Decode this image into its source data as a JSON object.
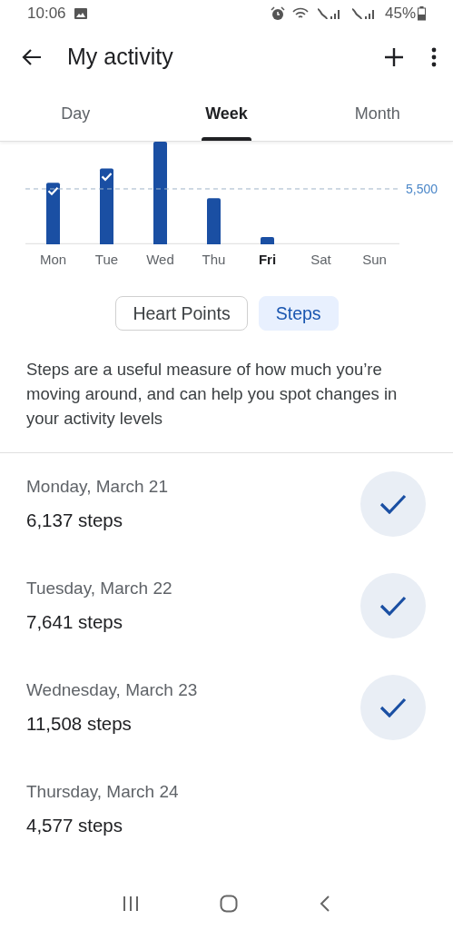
{
  "status_bar": {
    "time": "10:06",
    "battery": "45%"
  },
  "header": {
    "title": "My activity"
  },
  "tabs": [
    {
      "label": "Day",
      "selected": false
    },
    {
      "label": "Week",
      "selected": true
    },
    {
      "label": "Month",
      "selected": false
    }
  ],
  "chart": {
    "goal_label": "5,500",
    "days": [
      {
        "label": "Mon",
        "selected": false,
        "goal_met": true
      },
      {
        "label": "Tue",
        "selected": false,
        "goal_met": true
      },
      {
        "label": "Wed",
        "selected": false,
        "goal_met": false
      },
      {
        "label": "Thu",
        "selected": false,
        "goal_met": false
      },
      {
        "label": "Fri",
        "selected": true,
        "goal_met": false
      },
      {
        "label": "Sat",
        "selected": false,
        "goal_met": false
      },
      {
        "label": "Sun",
        "selected": false,
        "goal_met": false
      }
    ]
  },
  "metric_toggle": [
    {
      "label": "Heart Points",
      "selected": false
    },
    {
      "label": "Steps",
      "selected": true
    }
  ],
  "description": "Steps are a useful measure of how much you’re moving around, and can help you spot changes in your activity levels",
  "days": [
    {
      "date": "Monday, March 21",
      "steps": "6,137 steps",
      "goal_met": true
    },
    {
      "date": "Tuesday, March 22",
      "steps": "7,641 steps",
      "goal_met": true
    },
    {
      "date": "Wednesday, March 23",
      "steps": "11,508 steps",
      "goal_met": true
    },
    {
      "date": "Thursday, March 24",
      "steps": "4,577 steps",
      "goal_met": false
    }
  ]
}
